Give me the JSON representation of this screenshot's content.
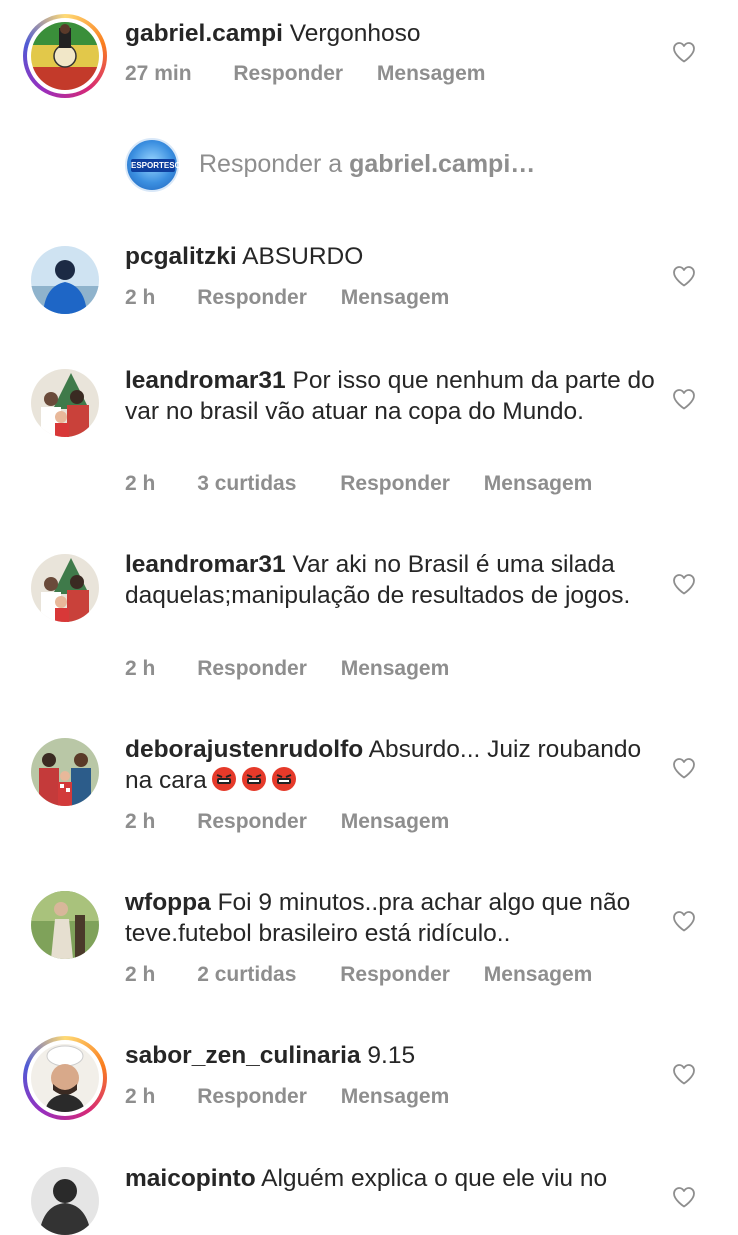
{
  "comments": [
    {
      "username": "gabriel.campi",
      "text": "Vergonhoso",
      "time": "27 min",
      "reply": "Responder",
      "message": "Mensagem"
    },
    {
      "username": "pcgalitzki",
      "text": "ABSURDO",
      "time": "2 h",
      "reply": "Responder",
      "message": "Mensagem"
    },
    {
      "username": "leandromar31",
      "text": "Por isso que nenhum da parte do var no brasil vão atuar na copa do Mundo.",
      "time": "2 h",
      "likes": "3 curtidas",
      "reply": "Responder",
      "message": "Mensagem"
    },
    {
      "username": "leandromar31",
      "text": "Var aki no Brasil é uma silada daquelas;manipulação de resultados de jogos.",
      "time": "2 h",
      "reply": "Responder",
      "message": "Mensagem"
    },
    {
      "username": "deborajustenrudolfo",
      "text": "Absurdo... Juiz roubando na cara",
      "time": "2 h",
      "reply": "Responder",
      "message": "Mensagem"
    },
    {
      "username": "wfoppa",
      "text": "Foi 9 minutos..pra achar algo que não teve.futebol brasileiro está ridículo..",
      "time": "2 h",
      "likes": "2 curtidas",
      "reply": "Responder",
      "message": "Mensagem"
    },
    {
      "username": "sabor_zen_culinaria",
      "text": "9.15",
      "time": "2 h",
      "reply": "Responder",
      "message": "Mensagem"
    },
    {
      "username": "maicopinto",
      "text": "Alguém explica o que ele viu no"
    }
  ],
  "reply_prompt": {
    "prefix": "Responder a",
    "target": "gabriel.campi…",
    "avatar_text": "ESPORTESC"
  },
  "colors": {
    "text": "#262626",
    "secondary": "#8e8e8e",
    "story_ring": [
      "#feda75",
      "#fa7e1e",
      "#d62976",
      "#962fbf",
      "#4f5bd5"
    ]
  },
  "icons": {
    "like": "heart-outline-icon",
    "emoji": "angry-face-emoji"
  }
}
